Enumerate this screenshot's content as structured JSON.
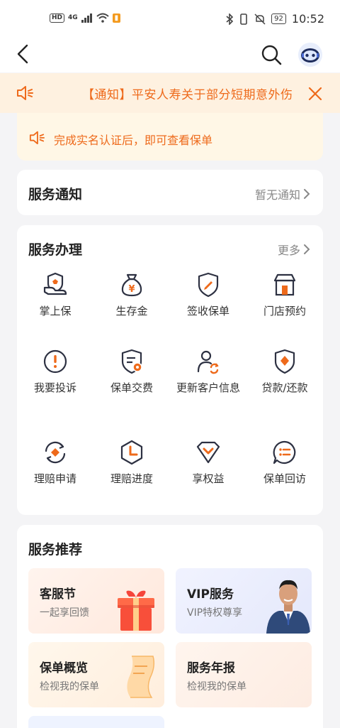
{
  "status_bar": {
    "hd": "HD",
    "network": "4G",
    "battery": "92",
    "time": "10:52"
  },
  "notice": {
    "text": "【通知】平安人寿关于部分短期意外伤"
  },
  "cert": {
    "text": "完成实名认证后，即可查看保单"
  },
  "service_notice": {
    "title": "服务通知",
    "status": "暂无通知"
  },
  "service_handle": {
    "title": "服务办理",
    "more": "更多",
    "items": [
      {
        "label": "掌上保",
        "icon": "hand-shield-icon"
      },
      {
        "label": "生存金",
        "icon": "money-bag-icon"
      },
      {
        "label": "签收保单",
        "icon": "shield-pen-icon"
      },
      {
        "label": "门店预约",
        "icon": "store-icon"
      },
      {
        "label": "我要投诉",
        "icon": "exclamation-icon"
      },
      {
        "label": "保单交费",
        "icon": "policy-pay-icon"
      },
      {
        "label": "更新客户信息",
        "icon": "user-refresh-icon"
      },
      {
        "label": "贷款/还款",
        "icon": "shield-diamond-icon"
      },
      {
        "label": "理赔申请",
        "icon": "claim-refresh-icon"
      },
      {
        "label": "理赔进度",
        "icon": "hexagon-clock-icon"
      },
      {
        "label": "享权益",
        "icon": "diamond-badge-icon"
      },
      {
        "label": "保单回访",
        "icon": "chat-list-icon"
      }
    ]
  },
  "service_recommend": {
    "title": "服务推荐",
    "cards": [
      {
        "title": "客服节",
        "subtitle": "一起享回馈"
      },
      {
        "title": "VIP服务",
        "subtitle": "VIP特权尊享"
      },
      {
        "title": "保单概览",
        "subtitle": "检视我的保单"
      },
      {
        "title": "服务年报",
        "subtitle": "检视我的保单"
      }
    ]
  },
  "colors": {
    "accent": "#ee6a1b",
    "notice_bg": "#fef1e0",
    "icon_dark": "#2d3142"
  }
}
